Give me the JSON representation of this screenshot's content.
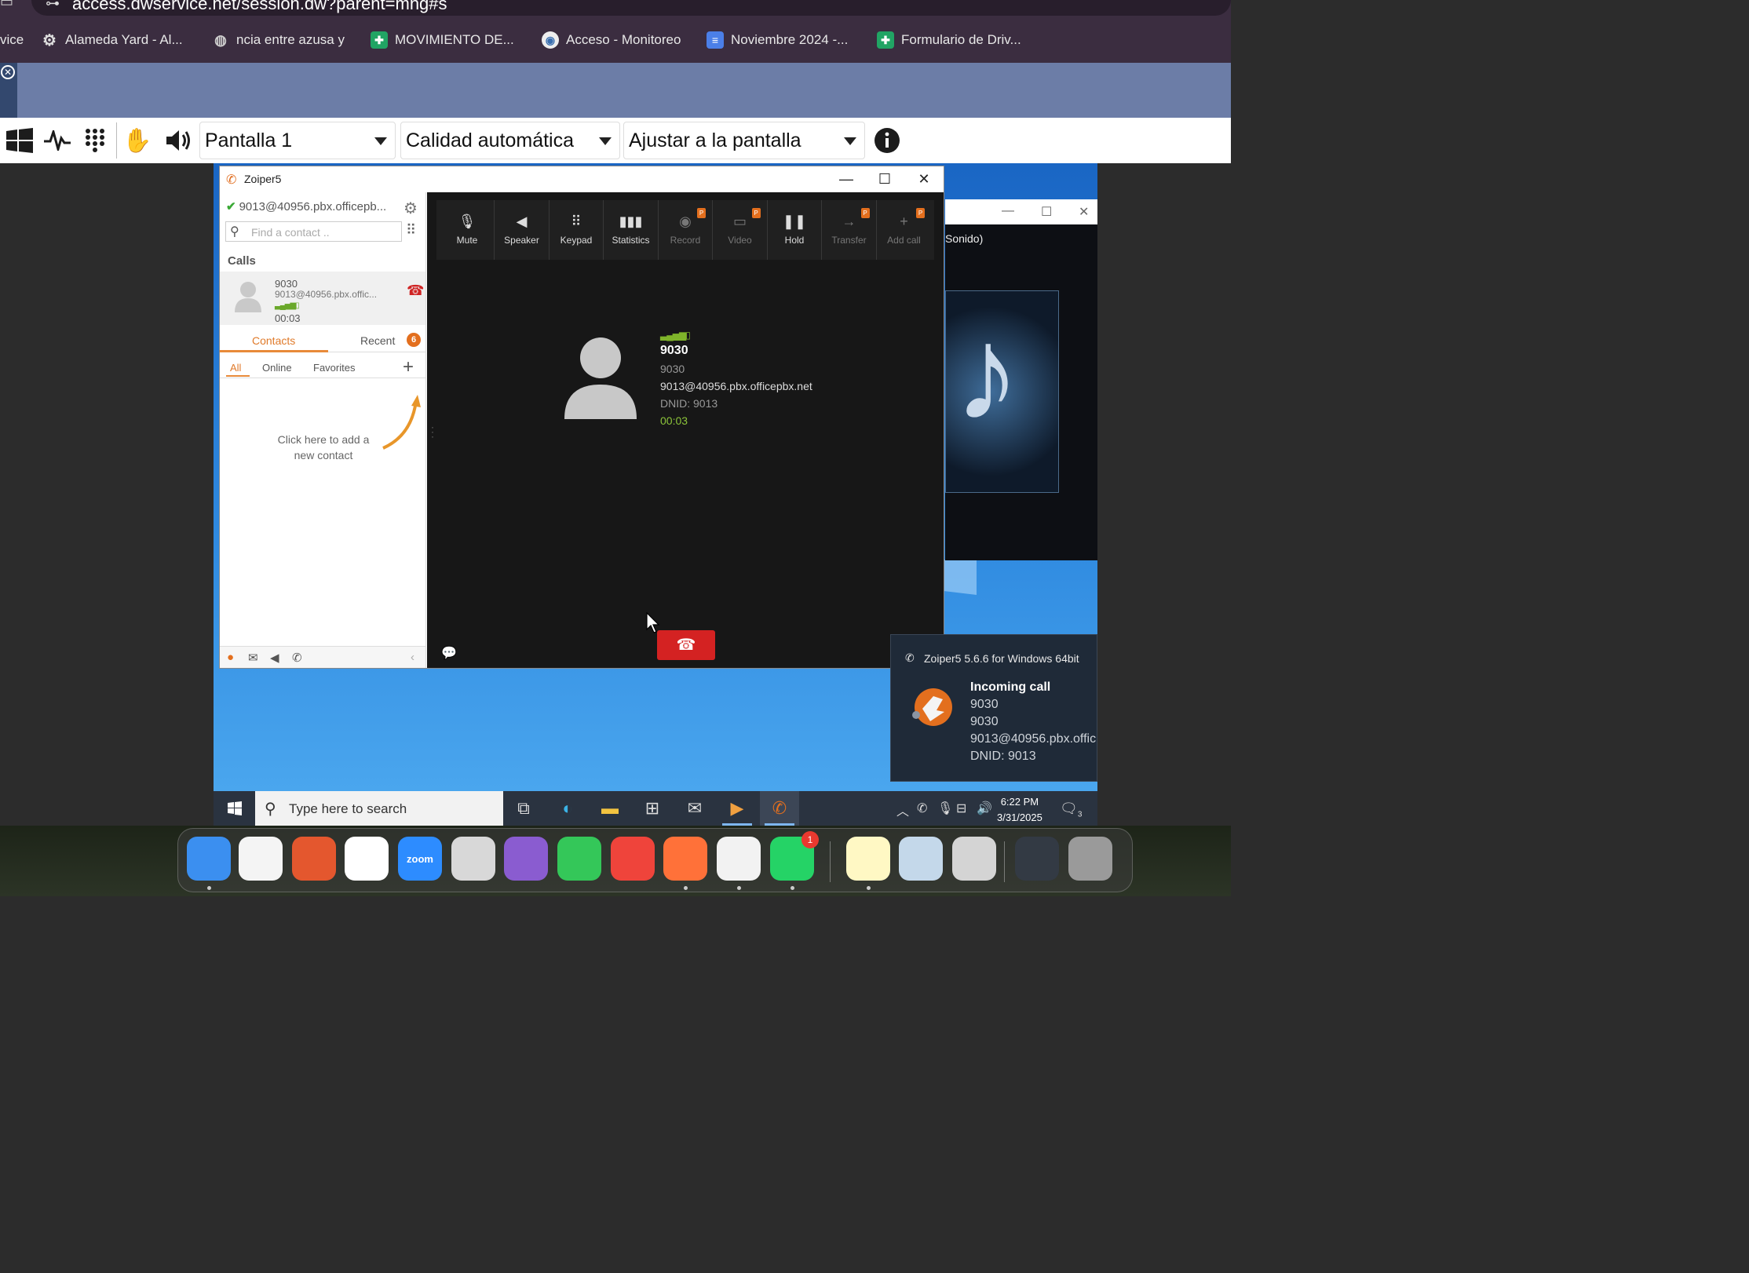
{
  "browser": {
    "url": "access.dwservice.net/session.dw?parent=mng#s",
    "bookmarks": [
      {
        "label": "vice",
        "icon": "none"
      },
      {
        "label": "Alameda Yard - Al...",
        "icon": "gear-icon"
      },
      {
        "label": "ncia entre azusa y",
        "icon": "globe-icon"
      },
      {
        "label": "MOVIMIENTO DE...",
        "icon": "sheets-icon"
      },
      {
        "label": "Acceso - Monitoreo",
        "icon": "camera-icon"
      },
      {
        "label": "Noviembre 2024 -...",
        "icon": "docs-icon"
      },
      {
        "label": "Formulario de Driv...",
        "icon": "sheets-icon"
      }
    ]
  },
  "dw_toolbar": {
    "screen_select": "Pantalla 1",
    "quality_select": "Calidad automática",
    "fit_select": "Ajustar a la pantalla"
  },
  "zoiper": {
    "window_title": "Zoiper5",
    "account": "9013@40956.pbx.officepb...",
    "search_placeholder": "Find a contact ..",
    "calls_header": "Calls",
    "call_item": {
      "number": "9030",
      "uri": "9013@40956.pbx.offic...",
      "duration": "00:03"
    },
    "tabs": {
      "contacts": "Contacts",
      "recent": "Recent",
      "recent_badge": "6"
    },
    "filters": {
      "all": "All",
      "online": "Online",
      "favorites": "Favorites"
    },
    "add_contact_hint": "Click here to add a new contact",
    "toolbar": [
      {
        "label": "Mute",
        "icon": "mic-off-icon",
        "glyph": "🎙",
        "dim": false,
        "pro": false
      },
      {
        "label": "Speaker",
        "icon": "speaker-icon",
        "glyph": "◀",
        "dim": false,
        "pro": false
      },
      {
        "label": "Keypad",
        "icon": "keypad-icon",
        "glyph": "⠿",
        "dim": false,
        "pro": false
      },
      {
        "label": "Statistics",
        "icon": "statistics-icon",
        "glyph": "▮▮▮",
        "dim": false,
        "pro": false
      },
      {
        "label": "Record",
        "icon": "record-icon",
        "glyph": "◉",
        "dim": true,
        "pro": true
      },
      {
        "label": "Video",
        "icon": "video-icon",
        "glyph": "▭",
        "dim": true,
        "pro": true
      },
      {
        "label": "Hold",
        "icon": "pause-icon",
        "glyph": "❚❚",
        "dim": false,
        "pro": false
      },
      {
        "label": "Transfer",
        "icon": "transfer-icon",
        "glyph": "→",
        "dim": true,
        "pro": true
      },
      {
        "label": "Add call",
        "icon": "plus-icon",
        "glyph": "+",
        "dim": true,
        "pro": true
      }
    ],
    "pro_badge": "P",
    "active_call": {
      "name": "9030",
      "number": "9030",
      "uri": "9013@40956.pbx.officepbx.net",
      "dnid": "DNID: 9013",
      "timer": "00:03"
    }
  },
  "behind_window": {
    "text": "Sonido)"
  },
  "notification": {
    "app": "Zoiper5 5.6.6 for Windows 64bit",
    "title": "Incoming call",
    "line1": "9030",
    "line2": "9030",
    "line3": "9013@40956.pbx.offic",
    "line4": "DNID: 9013"
  },
  "taskbar": {
    "search_placeholder": "Type here to search",
    "time": "6:22 PM",
    "date": "3/31/2025",
    "notification_count": "3"
  },
  "dock": {
    "apps": [
      {
        "name": "finder-icon",
        "color": "#3b8ff0",
        "label": ""
      },
      {
        "name": "photos-icon",
        "color": "#f4f4f4",
        "label": ""
      },
      {
        "name": "rustdesk-icon",
        "color": "#e4572e",
        "label": ""
      },
      {
        "name": "v-app-icon",
        "color": "#ffffff",
        "label": ""
      },
      {
        "name": "zoom-icon",
        "color": "#2d8cff",
        "label": "zoom"
      },
      {
        "name": "launchpad-icon",
        "color": "#d8d8d8",
        "label": ""
      },
      {
        "name": "podcast-icon",
        "color": "#8a5cd0",
        "label": ""
      },
      {
        "name": "messages-icon",
        "color": "#34c759",
        "label": ""
      },
      {
        "name": "anydesk-icon",
        "color": "#ef443b",
        "label": ""
      },
      {
        "name": "firefox-icon",
        "color": "#ff7139",
        "label": ""
      },
      {
        "name": "chrome-icon",
        "color": "#f2f2f2",
        "label": ""
      },
      {
        "name": "whatsapp-icon",
        "color": "#25d366",
        "label": ""
      },
      {
        "name": "notes-icon",
        "color": "#fff8c4",
        "label": ""
      },
      {
        "name": "preview-icon",
        "color": "#c4d8ea",
        "label": ""
      },
      {
        "name": "calculator-icon",
        "color": "#d4d4d4",
        "label": ""
      },
      {
        "name": "window-thumb-icon",
        "color": "#333a44",
        "label": ""
      },
      {
        "name": "trash-icon",
        "color": "#9a9a9a",
        "label": ""
      }
    ],
    "whatsapp_badge": "1"
  }
}
